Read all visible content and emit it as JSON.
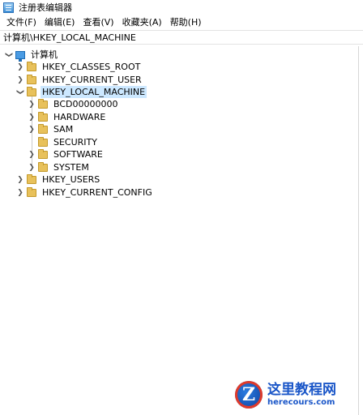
{
  "window": {
    "title": "注册表编辑器"
  },
  "menu": [
    {
      "label": "文件(F)"
    },
    {
      "label": "编辑(E)"
    },
    {
      "label": "查看(V)"
    },
    {
      "label": "收藏夹(A)"
    },
    {
      "label": "帮助(H)"
    }
  ],
  "address": {
    "path": "计算机\\HKEY_LOCAL_MACHINE"
  },
  "tree": {
    "root": {
      "label": "计算机",
      "state": "expanded"
    },
    "nodes": [
      {
        "label": "HKEY_CLASSES_ROOT",
        "state": "collapsed"
      },
      {
        "label": "HKEY_CURRENT_USER",
        "state": "collapsed"
      },
      {
        "label": "HKEY_LOCAL_MACHINE",
        "state": "expanded",
        "selected": true
      },
      {
        "label": "BCD00000000",
        "state": "collapsed"
      },
      {
        "label": "HARDWARE",
        "state": "collapsed"
      },
      {
        "label": "SAM",
        "state": "collapsed"
      },
      {
        "label": "SECURITY",
        "state": "leaf"
      },
      {
        "label": "SOFTWARE",
        "state": "collapsed"
      },
      {
        "label": "SYSTEM",
        "state": "collapsed"
      },
      {
        "label": "HKEY_USERS",
        "state": "collapsed"
      },
      {
        "label": "HKEY_CURRENT_CONFIG",
        "state": "collapsed"
      }
    ]
  },
  "watermark": {
    "name": "这里教程网",
    "url": "herecours.com"
  },
  "colors": {
    "selection": "#cce8ff",
    "folder": "#e8c15b",
    "watermark_blue": "#1a56c8"
  }
}
